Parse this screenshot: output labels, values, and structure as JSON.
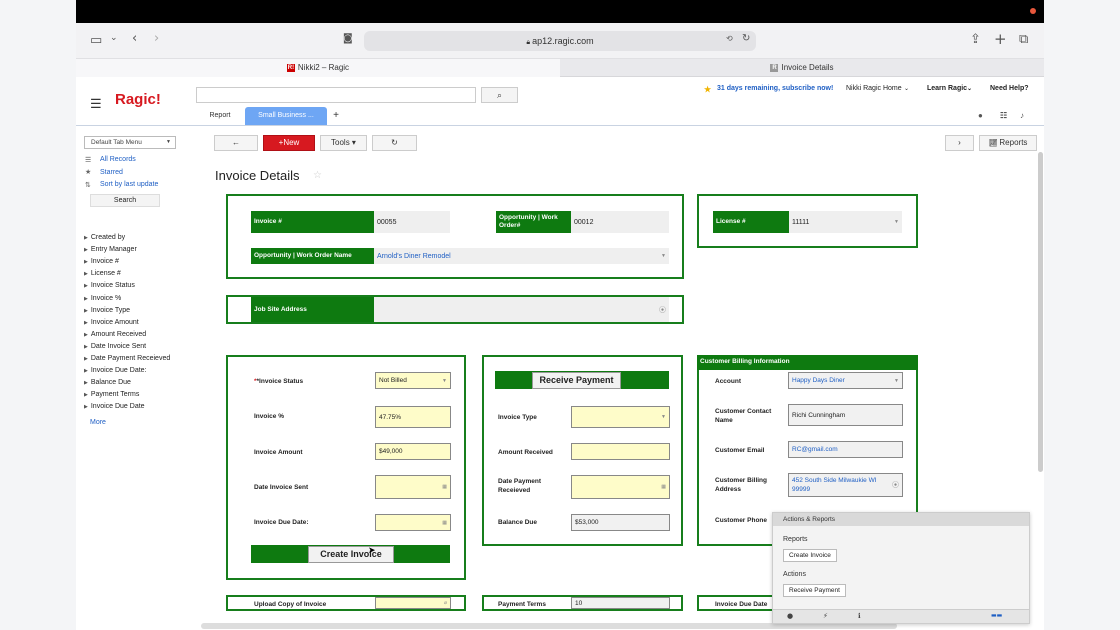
{
  "browser": {
    "url": "ap12.ragic.com",
    "tabs": [
      {
        "label": "Nikki2 – Ragic",
        "favicon": "R!"
      },
      {
        "label": "Invoice Details",
        "favicon": "R"
      }
    ]
  },
  "header": {
    "logo": "Ragic!",
    "trial": "31 days remaining, subscribe now!",
    "account": "Nikki Ragic Home",
    "learn": "Learn Ragic",
    "help": "Need Help?",
    "tabs": [
      {
        "label": "Report"
      },
      {
        "label": "Small Business ..."
      },
      {
        "label": "+"
      }
    ]
  },
  "sidebar": {
    "tab_menu": "Default Tab Menu",
    "links": [
      {
        "label": "All Records"
      },
      {
        "label": "Starred"
      },
      {
        "label": "Sort by last update"
      }
    ],
    "search_label": "Search",
    "fields": [
      "Created by",
      "Entry Manager",
      "Invoice #",
      "License #",
      "Invoice Status",
      "Invoice %",
      "Invoice Type",
      "Invoice Amount",
      "Amount Received",
      "Date Invoice Sent",
      "Date Payment Receieved",
      "Invoice Due Date:",
      "Balance Due",
      "Payment Terms",
      "Invoice Due Date"
    ],
    "more": "More"
  },
  "toolbar": {
    "back": "←",
    "new": "+New",
    "tools": "Tools ▾",
    "refresh": "↻",
    "next": "›",
    "reports": "Reports"
  },
  "page": {
    "title": "Invoice Details"
  },
  "top_section": {
    "invoice_num_label": "Invoice #",
    "invoice_num": "00055",
    "opp_label": "Opportunity | Work Order#",
    "opp_value": "00012",
    "opp_name_label": "Opportunity | Work Order Name",
    "opp_name": "Arnold's Diner Remodel",
    "license_label": "License #",
    "license_value": "11111",
    "job_site_label": "Job Site Address",
    "job_site_value": ""
  },
  "invoice_panel": {
    "status_label": "*Invoice Status",
    "status": "Not Billed",
    "pct_label": "Invoice %",
    "pct": "47.75%",
    "amount_label": "Invoice Amount",
    "amount": "$49,000",
    "sent_label": "Date Invoice Sent",
    "sent": "",
    "due_label": "Invoice Due Date:",
    "due": "",
    "create_btn": "Create Invoice"
  },
  "payment_panel": {
    "receive_btn": "Receive Payment",
    "type_label": "Invoice Type",
    "received_label": "Amount Received",
    "date_label": "Date Payment Receieved",
    "balance_label": "Balance Due",
    "balance": "$53,000"
  },
  "billing_panel": {
    "header": "Customer Billing Information",
    "account_label": "Account",
    "account": "Happy Days Diner",
    "contact_label": "Customer Contact Name",
    "contact": "Richi Cunningham",
    "email_label": "Customer Email",
    "email": "RC@gmail.com",
    "address_label": "Customer Billing Address",
    "address": "452 South Side Milwaukie WI 99999",
    "phone_label": "Customer Phone"
  },
  "bottom_row": {
    "upload_label": "Upload Copy of Invoice",
    "terms_label": "Payment Terms",
    "terms": "10",
    "due_label": "Invoice Due Date"
  },
  "actions_panel": {
    "title": "Actions & Reports",
    "reports_label": "Reports",
    "create_invoice": "Create Invoice",
    "actions_label": "Actions",
    "receive_payment": "Receive Payment"
  }
}
